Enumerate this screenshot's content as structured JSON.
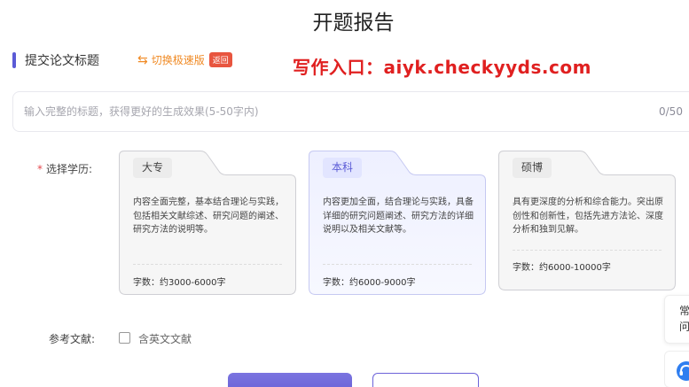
{
  "page": {
    "title": "开题报告"
  },
  "header": {
    "section_label": "提交论文标题",
    "switch_label": "切换极速版",
    "switch_icon": "swap-arrows-icon",
    "back_badge": "返回",
    "promo_text": "写作入口：aiyk.checkyyds.com"
  },
  "title_input": {
    "value": "",
    "placeholder": "输入完整的标题，获得更好的生成效果(5-50字内)",
    "counter": "0/50"
  },
  "education": {
    "required_mark": "*",
    "label": "选择学历:",
    "selected": "本科",
    "options": [
      {
        "name": "大专",
        "desc": "内容全面完整，基本结合理论与实践，包括相关文献综述、研究问题的阐述、研究方法的说明等。",
        "words": "字数：约3000-6000字"
      },
      {
        "name": "本科",
        "desc": "内容更加全面，结合理论与实践，具备详细的研究问题阐述、研究方法的详细说明以及相关文献等。",
        "words": "字数：约6000-9000字"
      },
      {
        "name": "硕博",
        "desc": "具有更深度的分析和综合能力。突出原创性和创新性，包括先进方法论、深度分析和独到见解。",
        "words": "字数：约6000-10000字"
      }
    ]
  },
  "references": {
    "label": "参考文献:",
    "checkbox_label": "含英文文献",
    "checked": false
  },
  "side": {
    "line1": "常",
    "line2": "问",
    "help_icon": "customer-service-icon"
  },
  "colors": {
    "accent": "#5b5bd6",
    "promo": "#e02020",
    "switch": "#f08a24",
    "badge": "#e8553f"
  }
}
